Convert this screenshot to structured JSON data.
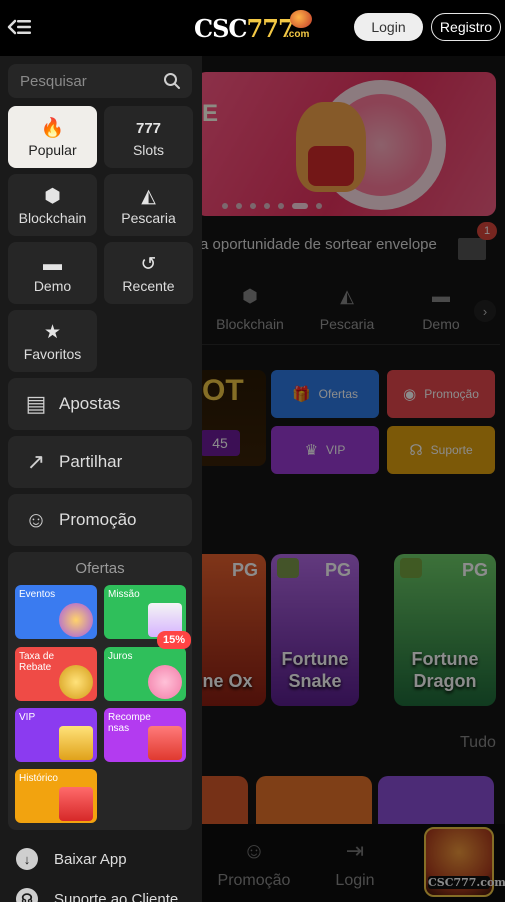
{
  "header": {
    "logo_main": "CSC",
    "logo_num": "777",
    "logo_suffix": ".com",
    "login_label": "Login",
    "register_label": "Registro"
  },
  "drawer": {
    "search_placeholder": "Pesquisar",
    "tiles": [
      {
        "label": "Popular",
        "icon": "fire-icon"
      },
      {
        "label": "Slots",
        "icon": "slots-777-icon"
      },
      {
        "label": "Blockchain",
        "icon": "blockchain-icon"
      },
      {
        "label": "Pescaria",
        "icon": "shark-icon"
      },
      {
        "label": "Demo",
        "icon": "gamepad-icon"
      },
      {
        "label": "Recente",
        "icon": "history-icon"
      },
      {
        "label": "Favoritos",
        "icon": "star-icon"
      }
    ],
    "menu": [
      {
        "label": "Apostas",
        "icon": "bets-icon"
      },
      {
        "label": "Partilhar",
        "icon": "share-icon"
      },
      {
        "label": "Promoção",
        "icon": "people-icon"
      }
    ],
    "ofertas": {
      "title": "Ofertas",
      "cards": [
        {
          "label": "Eventos",
          "color": "#3a7bf0"
        },
        {
          "label": "Missão",
          "color": "#2fbf5b"
        },
        {
          "label": "Taxa de Rebate",
          "color": "#ef4b46"
        },
        {
          "label": "Juros",
          "color": "#2fbf5b"
        },
        {
          "label": "VIP",
          "color": "#8b3bf0"
        },
        {
          "label": "Recompensas",
          "color": "#b33bf0"
        },
        {
          "label": "Histórico",
          "color": "#f2a30f"
        }
      ],
      "juros_badge": "15%"
    },
    "links": [
      {
        "label": "Baixar App",
        "icon": "download-icon"
      },
      {
        "label": "Suporte ao Cliente",
        "icon": "headset-icon"
      }
    ]
  },
  "background": {
    "banner_text": "E",
    "marquee": "a oportunidade de sortear envelope",
    "envelope_badge": "1",
    "categories": [
      "Blockchain",
      "Pescaria",
      "Demo"
    ],
    "promo_art_text": "OT",
    "promo_art_number": "45",
    "promo_buttons": [
      {
        "label": "Ofertas",
        "color": "#2f7be6"
      },
      {
        "label": "Promoção",
        "color": "#e5484d"
      },
      {
        "label": "VIP",
        "color": "#9b3bd6"
      },
      {
        "label": "Suporte",
        "color": "#e2a20f"
      }
    ],
    "games": [
      {
        "title": "une Ox",
        "brand": "PG",
        "color": "#c0392b"
      },
      {
        "title": "Fortune Snake",
        "brand": "PG",
        "color": "#8d3cc4"
      },
      {
        "title": "Fortune Dragon",
        "brand": "PG",
        "color": "#2e8b57"
      }
    ],
    "tudo_label": "Tudo",
    "bottom_nav": [
      {
        "label": "Promoção",
        "icon": "people-icon"
      },
      {
        "label": "Login",
        "icon": "login-icon"
      }
    ],
    "fab_label": "CSC777.com"
  }
}
